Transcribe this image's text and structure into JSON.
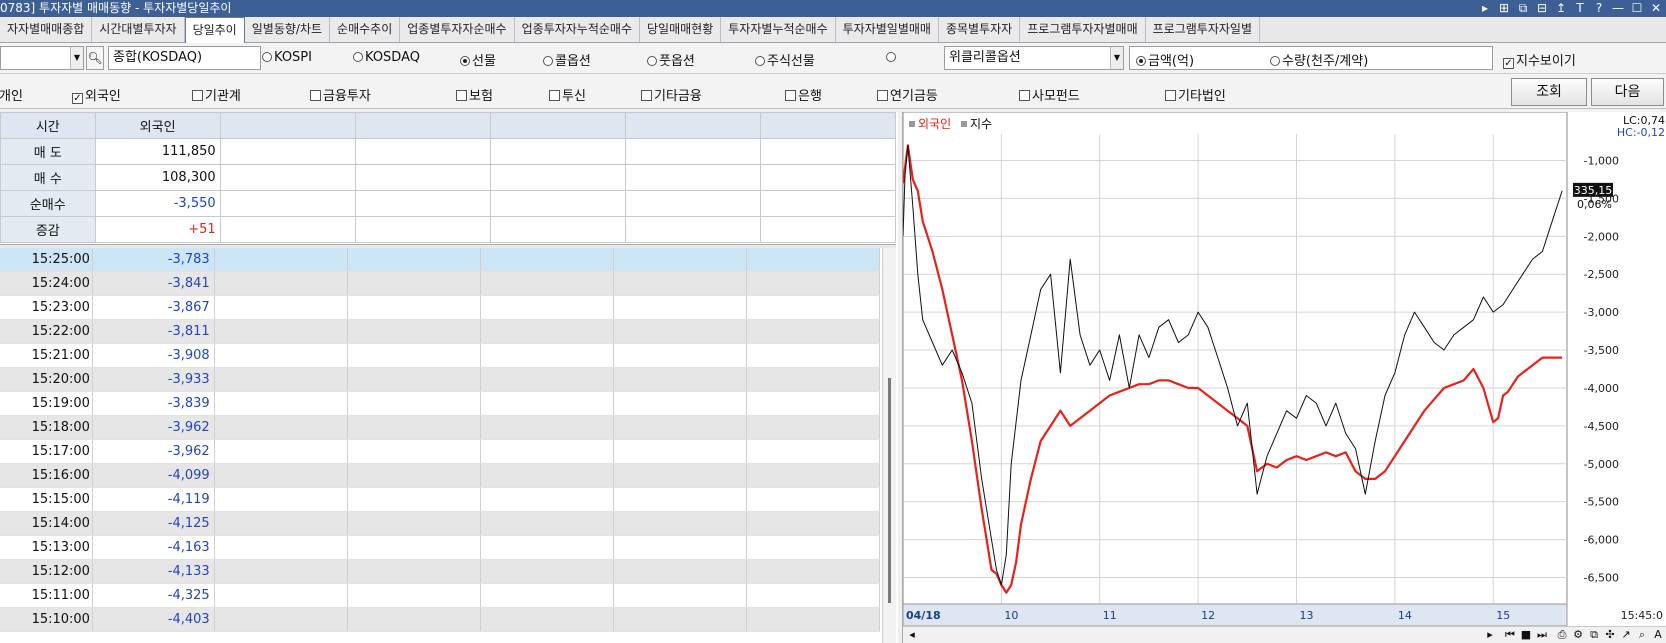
{
  "window": {
    "title": "0783] 투자자별 매매동향 - 투자자별당일추이",
    "controls": [
      "▸",
      "⊞",
      "⧉",
      "⊟",
      "↥",
      "T",
      "?",
      "—",
      "☐",
      "✕"
    ]
  },
  "tabs": [
    {
      "label": "자자별매매종합",
      "active": false
    },
    {
      "label": "시간대별투자자",
      "active": false
    },
    {
      "label": "당일추이",
      "active": true
    },
    {
      "label": "일별동향/차트",
      "active": false
    },
    {
      "label": "순매수추이",
      "active": false
    },
    {
      "label": "업종별투자자순매수",
      "active": false
    },
    {
      "label": "업종투자자누적순매수",
      "active": false
    },
    {
      "label": "당일매매현황",
      "active": false
    },
    {
      "label": "투자자별누적순매수",
      "active": false
    },
    {
      "label": "투자자별일별매매",
      "active": false
    },
    {
      "label": "종목별투자자",
      "active": false
    },
    {
      "label": "프로그램투자자별매매",
      "active": false
    },
    {
      "label": "프로그램투자자일별",
      "active": false
    }
  ],
  "options": {
    "code_value": "",
    "name_value": "종합(KOSDAQ)",
    "markets": [
      {
        "label": "KOSPI",
        "on": false
      },
      {
        "label": "KOSDAQ",
        "on": false
      },
      {
        "label": "선물",
        "on": true
      },
      {
        "label": "콜옵션",
        "on": false
      },
      {
        "label": "풋옵션",
        "on": false
      },
      {
        "label": "주식선물",
        "on": false
      },
      {
        "label": "",
        "on": false
      }
    ],
    "weekly_label": "위클리콜옵션",
    "units": [
      {
        "label": "금액(억)",
        "on": true
      },
      {
        "label": "수량(천주/계약)",
        "on": false
      }
    ],
    "show_index_label": "지수보이기",
    "show_index_checked": true
  },
  "investors": {
    "items": [
      {
        "label": "개인",
        "checked": false,
        "partial": true
      },
      {
        "label": "외국인",
        "checked": true
      },
      {
        "label": "기관계",
        "checked": false
      },
      {
        "label": "금융투자",
        "checked": false
      },
      {
        "label": "보험",
        "checked": false
      },
      {
        "label": "투신",
        "checked": false
      },
      {
        "label": "기타금융",
        "checked": false
      },
      {
        "label": "은행",
        "checked": false
      },
      {
        "label": "연기금등",
        "checked": false
      },
      {
        "label": "사모펀드",
        "checked": false
      },
      {
        "label": "기타법인",
        "checked": false
      }
    ],
    "query_button": "조회",
    "next_button": "다음"
  },
  "summary": {
    "header_time": "시간",
    "header_foreign": "외국인",
    "rows": [
      {
        "label": "매 도",
        "value": "111,850",
        "tone": "plain"
      },
      {
        "label": "매 수",
        "value": "108,300",
        "tone": "plain"
      },
      {
        "label": "순매수",
        "value": "-3,550",
        "tone": "neg"
      },
      {
        "label": "증감",
        "value": "+51",
        "tone": "pos"
      }
    ]
  },
  "timeseries": [
    {
      "time": "15:25:00",
      "value": "-3,783",
      "selected": true
    },
    {
      "time": "15:24:00",
      "value": "-3,841"
    },
    {
      "time": "15:23:00",
      "value": "-3,867"
    },
    {
      "time": "15:22:00",
      "value": "-3,811"
    },
    {
      "time": "15:21:00",
      "value": "-3,908"
    },
    {
      "time": "15:20:00",
      "value": "-3,933"
    },
    {
      "time": "15:19:00",
      "value": "-3,839"
    },
    {
      "time": "15:18:00",
      "value": "-3,962"
    },
    {
      "time": "15:17:00",
      "value": "-3,962"
    },
    {
      "time": "15:16:00",
      "value": "-4,099"
    },
    {
      "time": "15:15:00",
      "value": "-4,119"
    },
    {
      "time": "15:14:00",
      "value": "-4,125"
    },
    {
      "time": "15:13:00",
      "value": "-4,163"
    },
    {
      "time": "15:12:00",
      "value": "-4,133"
    },
    {
      "time": "15:11:00",
      "value": "-4,325"
    },
    {
      "time": "15:10:00",
      "value": "-4,403"
    }
  ],
  "chart_data": {
    "type": "line",
    "legend": [
      "외국인",
      "지수"
    ],
    "x_ticks": [
      "04/18",
      "10",
      "11",
      "12",
      "13",
      "14",
      "15",
      "15:45:0"
    ],
    "x_range_hours": [
      9,
      15.75
    ],
    "y_ticks": [
      "-1,000",
      "-1,500",
      "-2,000",
      "-2,500",
      "-3,000",
      "-3,500",
      "-4,000",
      "-4,500",
      "-5,000",
      "-5,500",
      "-6,000",
      "-6,500"
    ],
    "ylim": [
      -6850,
      -650
    ],
    "index_axis_labels": {
      "lc": "LC:0,74",
      "hc": "HC:-0,12",
      "current": "335,15",
      "pct": "0,06%"
    },
    "colors": {
      "foreign": "#e8221a",
      "index": "#111111"
    },
    "series": [
      {
        "name": "외국인",
        "x": [
          9.0,
          9.05,
          9.1,
          9.15,
          9.2,
          9.3,
          9.4,
          9.5,
          9.6,
          9.7,
          9.8,
          9.9,
          9.95,
          10.0,
          10.05,
          10.1,
          10.15,
          10.2,
          10.3,
          10.4,
          10.5,
          10.6,
          10.7,
          10.8,
          10.9,
          11.0,
          11.1,
          11.2,
          11.3,
          11.4,
          11.5,
          11.6,
          11.7,
          11.8,
          11.9,
          12.0,
          12.1,
          12.2,
          12.3,
          12.4,
          12.5,
          12.6,
          12.7,
          12.8,
          12.9,
          13.0,
          13.1,
          13.2,
          13.3,
          13.4,
          13.5,
          13.6,
          13.7,
          13.8,
          13.9,
          14.0,
          14.1,
          14.2,
          14.3,
          14.4,
          14.5,
          14.6,
          14.7,
          14.8,
          14.9,
          15.0,
          15.05,
          15.1,
          15.15,
          15.2,
          15.25,
          15.3,
          15.4,
          15.5,
          15.6,
          15.7
        ],
        "y": [
          -1300,
          -800,
          -1250,
          -1400,
          -1800,
          -2200,
          -2700,
          -3300,
          -3900,
          -4700,
          -5600,
          -6400,
          -6450,
          -6600,
          -6700,
          -6600,
          -6300,
          -5800,
          -5200,
          -4700,
          -4500,
          -4300,
          -4500,
          -4400,
          -4300,
          -4200,
          -4100,
          -4050,
          -4000,
          -3950,
          -3950,
          -3900,
          -3900,
          -3950,
          -4000,
          -4000,
          -4100,
          -4200,
          -4300,
          -4400,
          -4500,
          -5100,
          -5000,
          -5050,
          -4950,
          -4900,
          -4950,
          -4900,
          -4850,
          -4900,
          -4850,
          -5100,
          -5200,
          -5200,
          -5100,
          -4900,
          -4700,
          -4500,
          -4300,
          -4150,
          -4000,
          -3950,
          -3900,
          -3750,
          -4000,
          -4450,
          -4400,
          -4100,
          -4050,
          -3950,
          -3850,
          -3800,
          -3700,
          -3600,
          -3600,
          -3600
        ]
      },
      {
        "name": "지수",
        "x": [
          9.0,
          9.02,
          9.05,
          9.1,
          9.15,
          9.2,
          9.3,
          9.4,
          9.5,
          9.6,
          9.7,
          9.8,
          9.9,
          9.95,
          10.0,
          10.05,
          10.1,
          10.2,
          10.3,
          10.4,
          10.5,
          10.6,
          10.7,
          10.8,
          10.9,
          11.0,
          11.1,
          11.2,
          11.3,
          11.4,
          11.5,
          11.6,
          11.7,
          11.8,
          11.9,
          12.0,
          12.1,
          12.2,
          12.3,
          12.4,
          12.5,
          12.6,
          12.7,
          12.8,
          12.9,
          13.0,
          13.1,
          13.2,
          13.3,
          13.4,
          13.5,
          13.6,
          13.7,
          13.8,
          13.9,
          14.0,
          14.1,
          14.2,
          14.3,
          14.4,
          14.5,
          14.6,
          14.7,
          14.8,
          14.9,
          15.0,
          15.1,
          15.2,
          15.3,
          15.4,
          15.5,
          15.6,
          15.7
        ],
        "y": [
          -2000,
          -1200,
          -800,
          -1600,
          -2500,
          -3100,
          -3400,
          -3700,
          -3500,
          -3800,
          -4200,
          -5200,
          -6000,
          -6400,
          -6600,
          -6200,
          -5000,
          -3900,
          -3300,
          -2700,
          -2500,
          -3800,
          -2300,
          -3300,
          -3700,
          -3500,
          -3900,
          -3300,
          -4000,
          -3300,
          -3600,
          -3200,
          -3100,
          -3400,
          -3300,
          -3000,
          -3200,
          -3600,
          -4000,
          -4500,
          -4200,
          -5400,
          -4900,
          -4600,
          -4300,
          -4400,
          -4100,
          -4200,
          -4500,
          -4200,
          -4600,
          -4800,
          -5400,
          -4700,
          -4100,
          -3800,
          -3300,
          -3000,
          -3200,
          -3400,
          -3500,
          -3300,
          -3200,
          -3100,
          -2800,
          -3000,
          -2900,
          -2700,
          -2500,
          -2300,
          -2200,
          -1800,
          -1400
        ]
      }
    ]
  }
}
